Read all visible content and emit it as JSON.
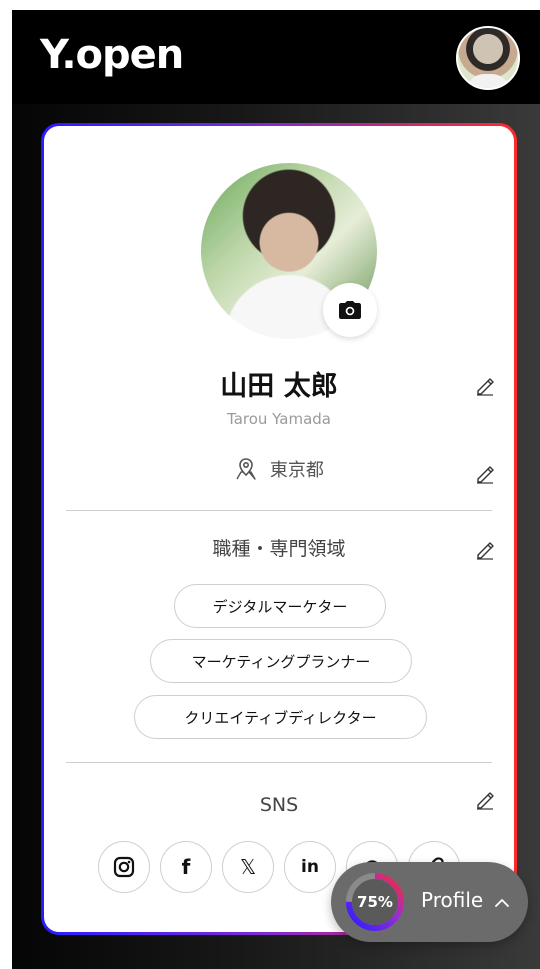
{
  "app": {
    "logo_text": "Y.open"
  },
  "profile": {
    "name": "山田 太郎",
    "romaji": "Tarou Yamada",
    "location": "東京都"
  },
  "sections": {
    "occupation_title": "職種・専門領域",
    "sns_title": "SNS"
  },
  "tags": [
    "デジタルマーケター",
    "マーケティングプランナー",
    "クリエイティブディレクター"
  ],
  "sns": {
    "items": [
      {
        "icon": "instagram-icon"
      },
      {
        "icon": "facebook-icon",
        "glyph": "f"
      },
      {
        "icon": "x-icon",
        "glyph": "𝕏"
      },
      {
        "icon": "linkedin-icon",
        "glyph": "in"
      },
      {
        "icon": "threads-icon",
        "glyph": "@"
      },
      {
        "icon": "link-icon"
      }
    ]
  },
  "profile_completion": {
    "percent_text": "75%",
    "label": "Profile",
    "progress": 0.75
  },
  "colors": {
    "gradient_start": "#2a1cff",
    "gradient_end": "#ff2a2a",
    "pill_bg": "#6b6b6b"
  }
}
